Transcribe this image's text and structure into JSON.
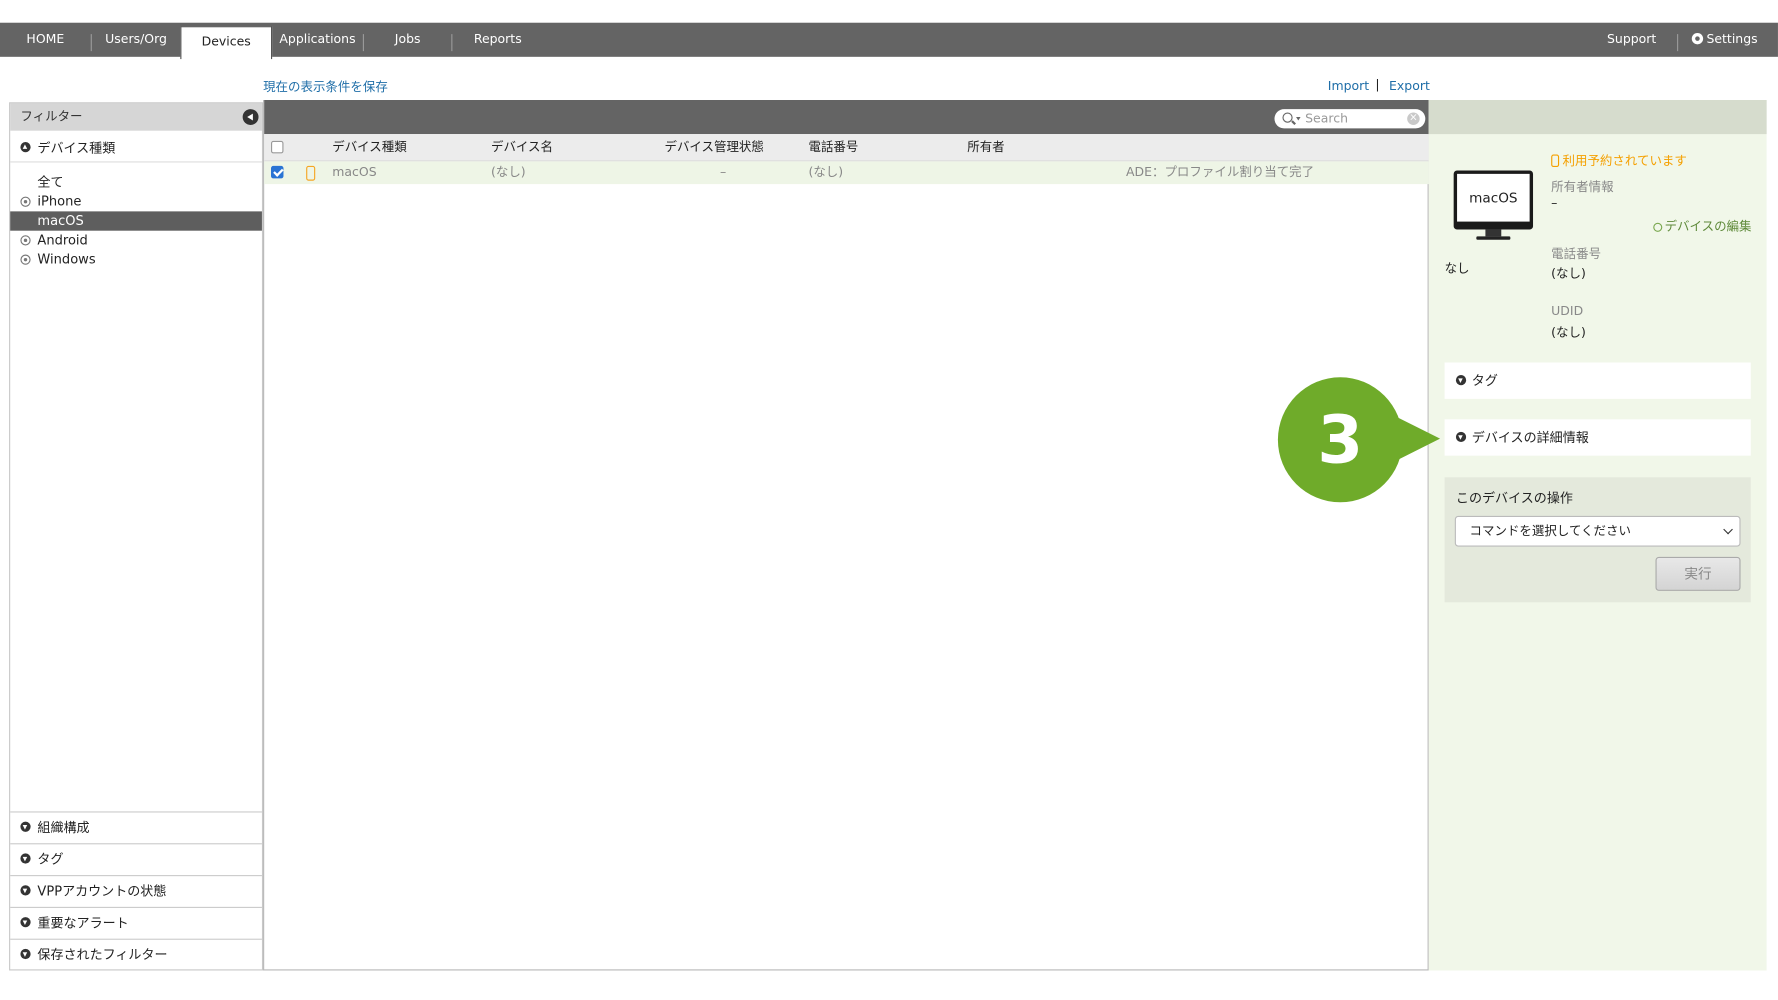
{
  "nav": {
    "tabs": [
      "HOME",
      "Users/Org",
      "Devices",
      "Applications",
      "Jobs",
      "Reports"
    ],
    "active_tab": "Devices",
    "support": "Support",
    "settings": "Settings"
  },
  "links": {
    "save_conditions": "現在の表示条件を保存",
    "import": "Import",
    "separator": "|",
    "export": "Export"
  },
  "filter": {
    "title": "フィルター",
    "device_type_header": "デバイス種類",
    "items": [
      "全て",
      "iPhone",
      "macOS",
      "Android",
      "Windows"
    ],
    "selected": "macOS",
    "bottom_sections": [
      "組織構成",
      "タグ",
      "VPPアカウントの状態",
      "重要なアラート",
      "保存されたフィルター"
    ]
  },
  "search": {
    "placeholder": "Search",
    "clear": "×"
  },
  "table": {
    "columns": [
      "デバイス種類",
      "デバイス名",
      "デバイス管理状態",
      "電話番号",
      "所有者"
    ],
    "rows": [
      {
        "type": "macOS",
        "name": "(なし)",
        "state": "–",
        "phone": "(なし)",
        "owner": "",
        "status": "ADE：プロファイル割り当て完了",
        "checked": true
      }
    ]
  },
  "detail": {
    "device_label": "macOS",
    "device_caption": "なし",
    "reserved_notice": "利用予約されています",
    "owner_label": "所有者情報",
    "owner_value": "–",
    "edit_link": "デバイスの編集",
    "phone_label": "電話番号",
    "phone_value": "(なし)",
    "udid_label": "UDID",
    "udid_value": "(なし)",
    "tags_section": "タグ",
    "details_section": "デバイスの詳細情報",
    "ops_title": "このデバイスの操作",
    "command_select": "コマンドを選択してください",
    "run_button": "実行"
  },
  "callout": {
    "number": "3"
  },
  "colors": {
    "nav_bg": "#646464",
    "accent_green": "#6fab2a",
    "warning": "#f5a000",
    "link": "#1f6ea8",
    "detail_bg": "#f1f7e9"
  }
}
